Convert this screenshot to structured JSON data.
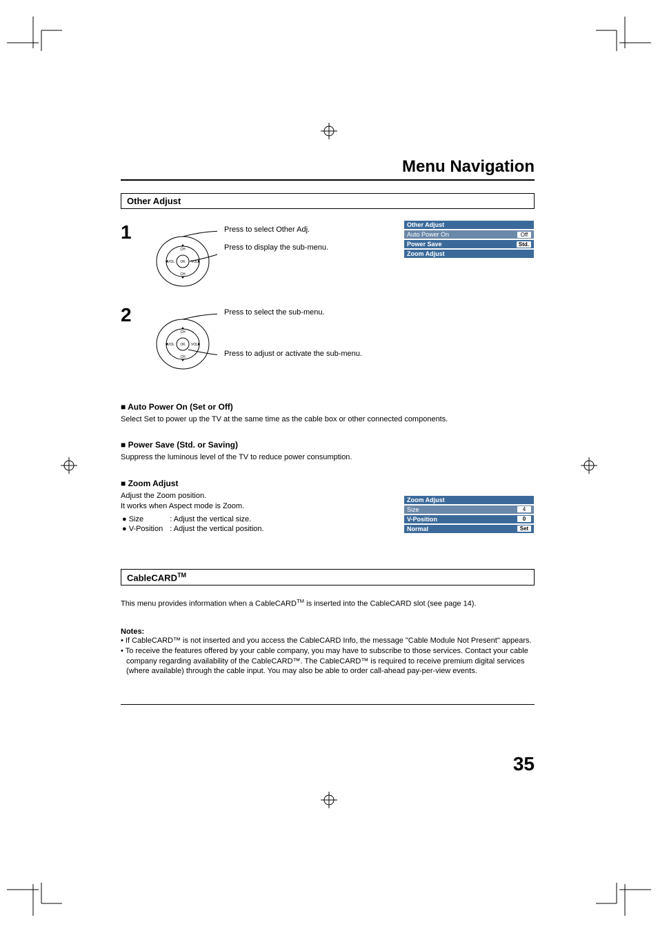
{
  "header": {
    "title": "Menu Navigation"
  },
  "sections": {
    "other_adjust": {
      "heading": "Other Adjust",
      "step1": {
        "num": "1",
        "line1": "Press to select Other Adj.",
        "line2": "Press to display the sub-menu."
      },
      "step2": {
        "num": "2",
        "line1": "Press to select the sub-menu.",
        "line2": "Press to adjust or activate the sub-menu."
      },
      "osd1": {
        "title": "Other Adjust",
        "rows": [
          {
            "label": "Auto Power On",
            "value": "Off",
            "hi": false
          },
          {
            "label": "Power Save",
            "value": "Std.",
            "hi": true
          },
          {
            "label": "Zoom Adjust",
            "value": "",
            "hi": true
          }
        ]
      },
      "auto_power": {
        "title": "Auto Power On (Set or Off)",
        "body": "Select Set to power up the TV at the same time as the cable box or other connected components."
      },
      "power_save": {
        "title": "Power Save (Std. or Saving)",
        "body": "Suppress the luminous level of the TV to reduce power consumption."
      },
      "zoom": {
        "title": "Zoom Adjust",
        "body1": "Adjust the Zoom position.",
        "body2": "It works when Aspect mode is Zoom.",
        "bullets": [
          {
            "label": "Size",
            "desc": ": Adjust the vertical size."
          },
          {
            "label": "V-Position",
            "desc": ": Adjust the vertical position."
          }
        ],
        "osd": {
          "title": "Zoom Adjust",
          "rows": [
            {
              "label": "Size",
              "value": "4",
              "hi": false
            },
            {
              "label": "V-Position",
              "value": "0",
              "hi": true
            },
            {
              "label": "Normal",
              "value": "Set",
              "hi": true
            }
          ]
        }
      }
    },
    "cablecard": {
      "heading_prefix": "CableCARD",
      "heading_suffix": "TM",
      "body_before": "This menu provides information when a CableCARD",
      "body_after": " is inserted into the CableCARD slot (see page 14).",
      "notes_head": "Notes:",
      "notes": [
        "If CableCARD™ is not inserted and you access the CableCARD Info, the message \"Cable Module Not Present\" appears.",
        "To receive the features offered by your cable company, you may have to subscribe to those services. Contact your cable company regarding availability of the CableCARD™. The CableCARD™ is required to receive premium digital services (where available) through the cable input. You may also be able to order call-ahead pay-per-view events."
      ]
    }
  },
  "page_number": "35",
  "remote_labels": {
    "ch": "CH",
    "vol": "VOL",
    "ok": "OK"
  }
}
